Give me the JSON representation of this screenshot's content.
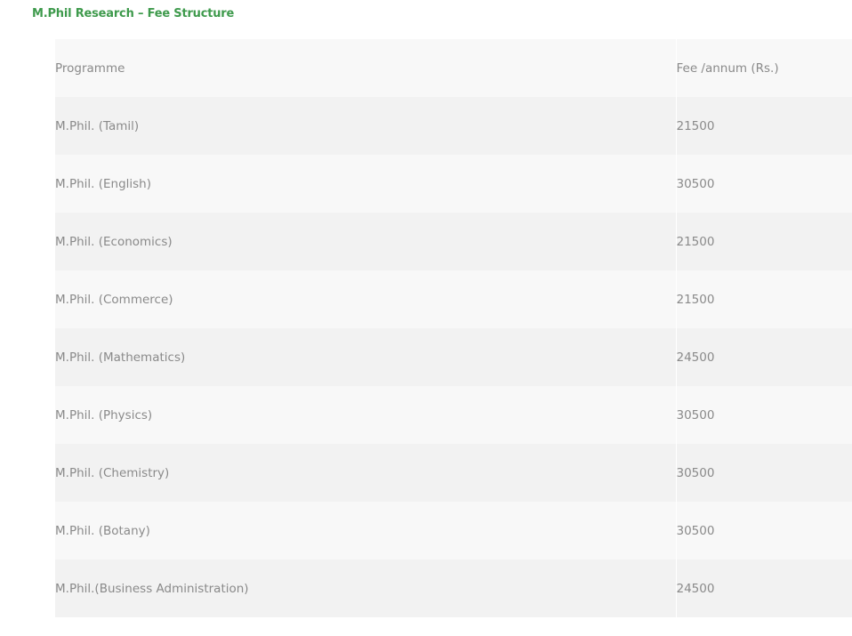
{
  "section": {
    "title": "M.Phil Research – Fee Structure",
    "title_color": "#3e9a4c"
  },
  "table": {
    "headers": [
      "Programme",
      "Fee /annum (Rs.)"
    ],
    "rows": [
      {
        "programme": "M.Phil. (Tamil)",
        "fee": "21500"
      },
      {
        "programme": "M.Phil. (English)",
        "fee": "30500"
      },
      {
        "programme": "M.Phil. (Economics)",
        "fee": "21500"
      },
      {
        "programme": "M.Phil. (Commerce)",
        "fee": "21500"
      },
      {
        "programme": "M.Phil. (Mathematics)",
        "fee": "24500"
      },
      {
        "programme": "M.Phil. (Physics)",
        "fee": "30500"
      },
      {
        "programme": "M.Phil. (Chemistry)",
        "fee": "30500"
      },
      {
        "programme": "M.Phil. (Botany)",
        "fee": "30500"
      },
      {
        "programme": "M.Phil.(Business Administration)",
        "fee": "24500"
      }
    ]
  }
}
